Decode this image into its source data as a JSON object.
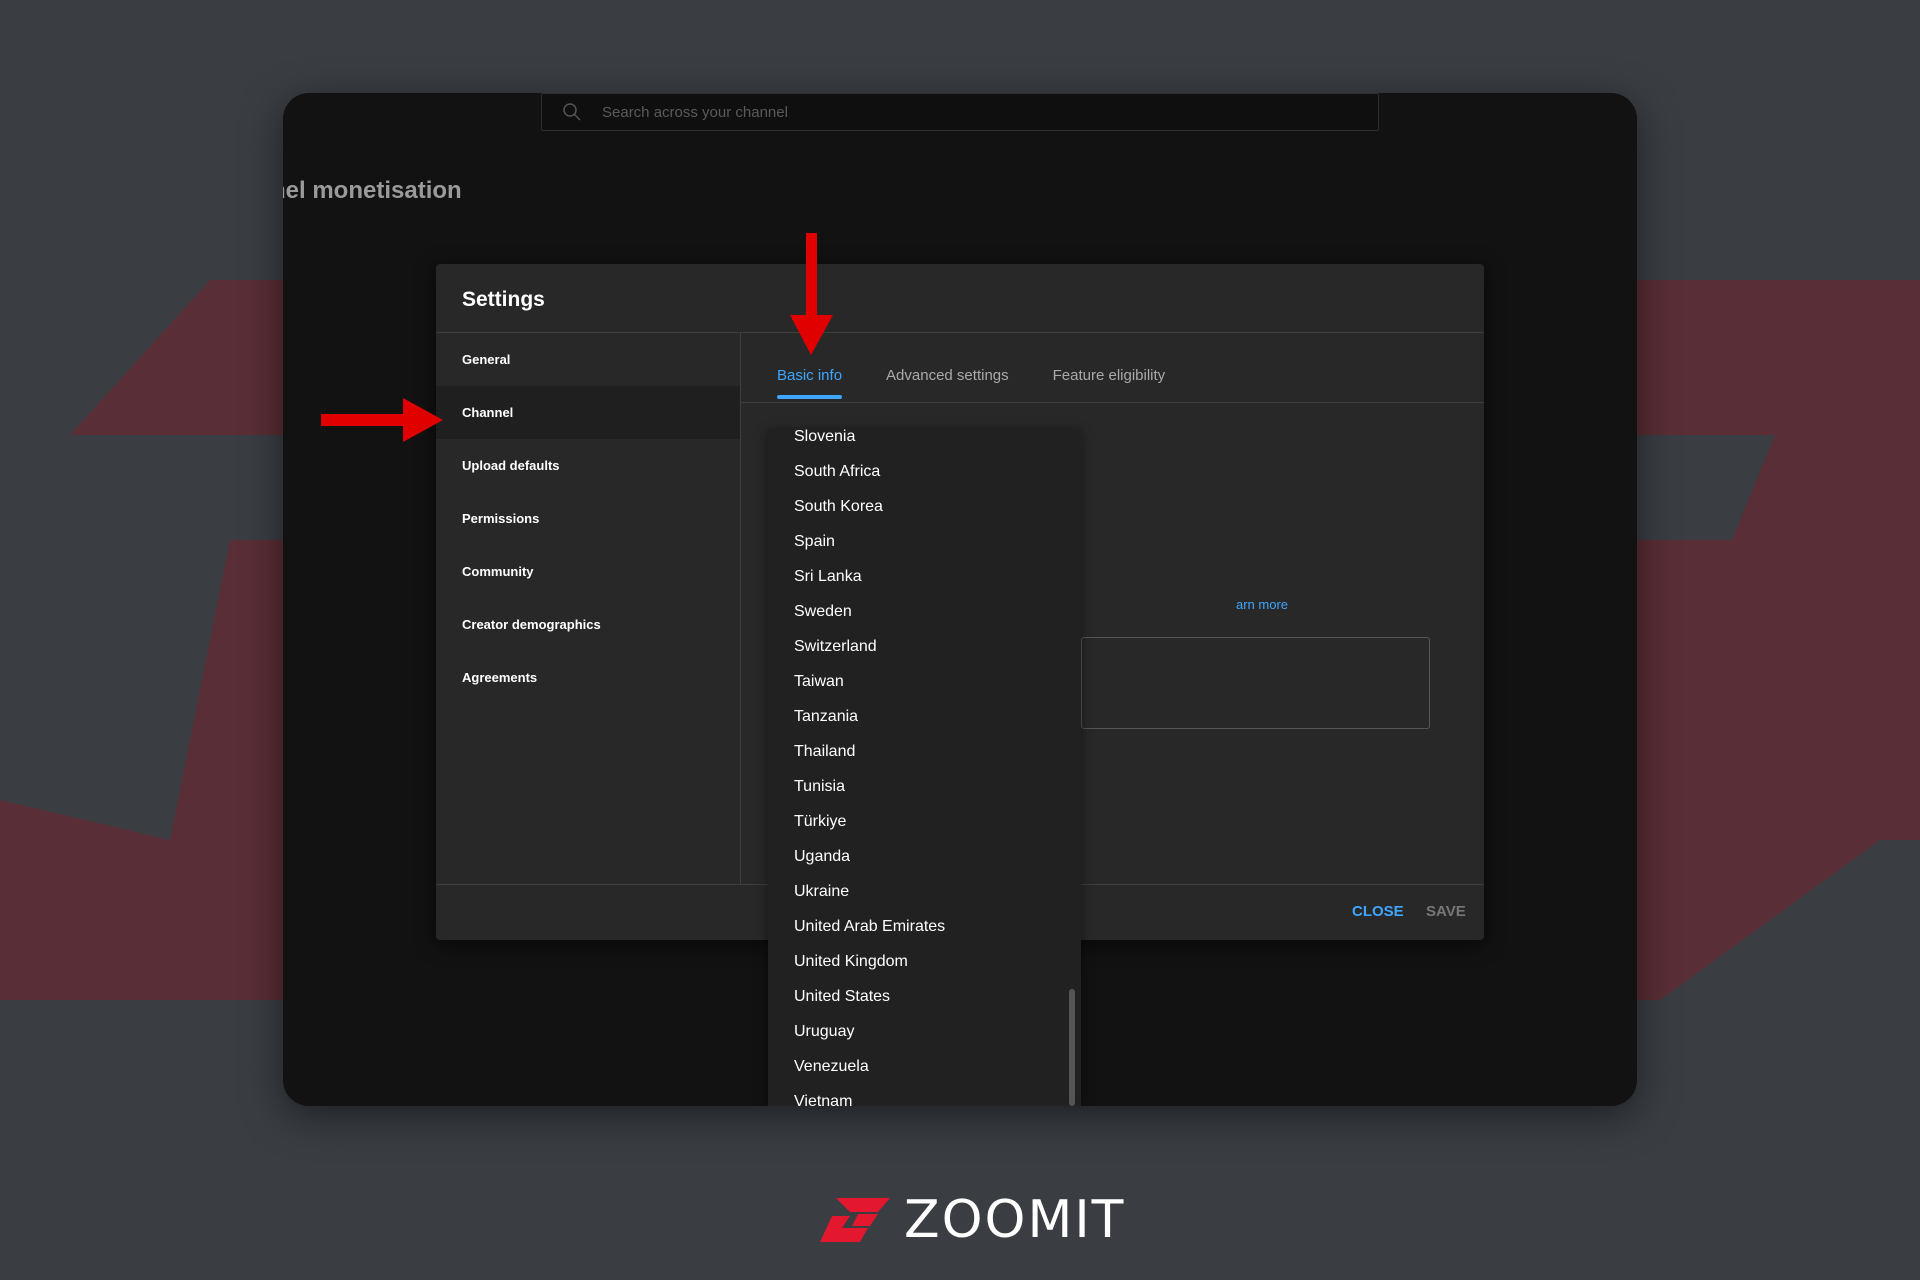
{
  "topbar": {
    "search_placeholder": "Search across your channel"
  },
  "page": {
    "title": "nel monetisation"
  },
  "dialog": {
    "title": "Settings",
    "sidebar": [
      {
        "label": "General"
      },
      {
        "label": "Channel",
        "active": true
      },
      {
        "label": "Upload defaults"
      },
      {
        "label": "Permissions"
      },
      {
        "label": "Community"
      },
      {
        "label": "Creator demographics"
      },
      {
        "label": "Agreements"
      }
    ],
    "tabs": [
      {
        "label": "Basic info",
        "active": true
      },
      {
        "label": "Advanced settings"
      },
      {
        "label": "Feature eligibility"
      }
    ],
    "learn_more": "arn more",
    "close_label": "CLOSE",
    "save_label": "SAVE"
  },
  "country_dropdown": {
    "options": [
      "Slovenia",
      "South Africa",
      "South Korea",
      "Spain",
      "Sri Lanka",
      "Sweden",
      "Switzerland",
      "Taiwan",
      "Tanzania",
      "Thailand",
      "Tunisia",
      "Türkiye",
      "Uganda",
      "Ukraine",
      "United Arab Emirates",
      "United Kingdom",
      "United States",
      "Uruguay",
      "Venezuela",
      "Vietnam"
    ]
  },
  "watermark": {
    "text": "ZOOMIT"
  },
  "colors": {
    "accent": "#3ea6ff",
    "arrow": "#e00000",
    "brand": "#e3172d"
  }
}
